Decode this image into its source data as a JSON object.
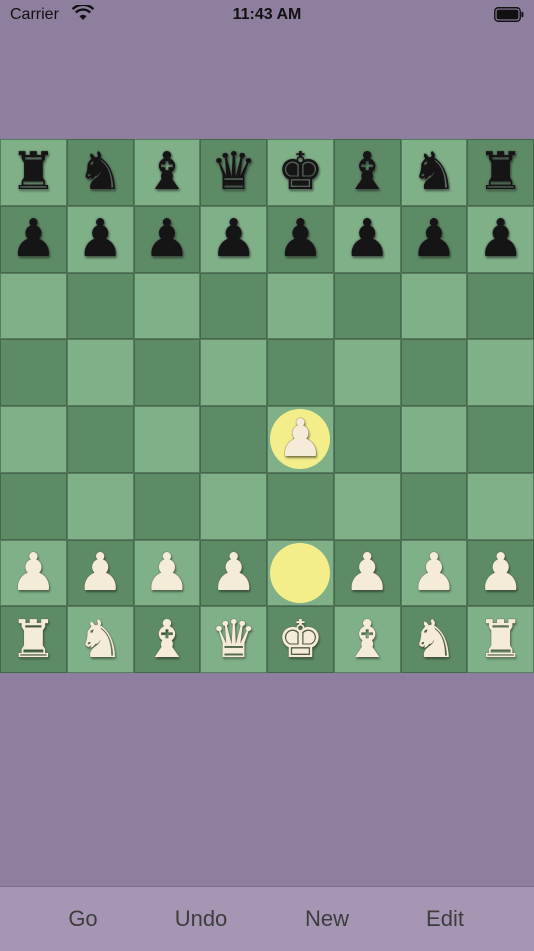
{
  "status_bar": {
    "carrier": "Carrier",
    "time": "11:43 AM"
  },
  "board": {
    "light_color": "#7fb088",
    "dark_color": "#5d8b66",
    "highlight_color": "#f3ee8a",
    "highlighted_squares": [
      "e4",
      "e2"
    ],
    "ranks": [
      [
        "br",
        "bn",
        "bb",
        "bq",
        "bk",
        "bb",
        "bn",
        "br"
      ],
      [
        "bp",
        "bp",
        "bp",
        "bp",
        "bp",
        "bp",
        "bp",
        "bp"
      ],
      [
        "",
        "",
        "",
        "",
        "",
        "",
        "",
        ""
      ],
      [
        "",
        "",
        "",
        "",
        "",
        "",
        "",
        ""
      ],
      [
        "",
        "",
        "",
        "",
        "wp",
        "",
        "",
        ""
      ],
      [
        "",
        "",
        "",
        "",
        "",
        "",
        "",
        ""
      ],
      [
        "wp",
        "wp",
        "wp",
        "wp",
        "",
        "wp",
        "wp",
        "wp"
      ],
      [
        "wr",
        "wn",
        "wb",
        "wq",
        "wk",
        "wb",
        "wn",
        "wr"
      ]
    ]
  },
  "toolbar": {
    "go_label": "Go",
    "undo_label": "Undo",
    "new_label": "New",
    "edit_label": "Edit"
  }
}
